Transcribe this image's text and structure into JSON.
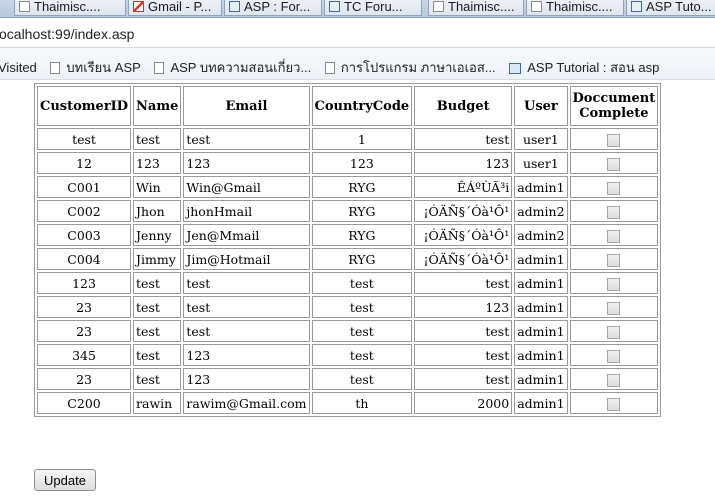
{
  "browser": {
    "tabs": [
      {
        "label": "Thaimisc....",
        "icon": "page-icon"
      },
      {
        "label": "Gmail - P...",
        "icon": "gmail-icon"
      },
      {
        "label": "ASP : For...",
        "icon": "asp-icon"
      },
      {
        "label": "TC Foru...",
        "icon": "asp-icon"
      },
      {
        "label": "Thaimisc....",
        "icon": "page-icon"
      },
      {
        "label": "Thaimisc....",
        "icon": "page-icon"
      },
      {
        "label": "ASP Tuto...",
        "icon": "asp-icon"
      }
    ],
    "address": "ocalhost:99/index.asp",
    "bookmarks": [
      {
        "label": "Visited",
        "icon": ""
      },
      {
        "label": "บทเรียน ASP",
        "icon": "page-icon"
      },
      {
        "label": "ASP บทความสอนเกี่ยว...",
        "icon": "page-icon"
      },
      {
        "label": "การโปรแกรม ภาษาเอเอส...",
        "icon": "page-icon"
      },
      {
        "label": "ASP Tutorial : สอน asp",
        "icon": "asp-icon"
      }
    ]
  },
  "table": {
    "headers": [
      "CustomerID",
      "Name",
      "Email",
      "CountryCode",
      "Budget",
      "User",
      "Doccument Complete"
    ],
    "header_doc_line1": "Doccument",
    "header_doc_line2": "Complete",
    "rows": [
      {
        "id": "test",
        "name": "test",
        "email": "test",
        "country": "1",
        "budget": "test",
        "user": "user1",
        "complete": false
      },
      {
        "id": "12",
        "name": "123",
        "email": "123",
        "country": "123",
        "budget": "123",
        "user": "user1",
        "complete": false
      },
      {
        "id": "C001",
        "name": "Win",
        "email": "Win@Gmail",
        "country": "RYG",
        "budget": "ÊÁºÙÃ³i",
        "user": "admin1",
        "complete": false
      },
      {
        "id": "C002",
        "name": "Jhon",
        "email": "jhonHmail",
        "country": "RYG",
        "budget": "¡ÓÄÑ§´Óà¹Ô¹",
        "user": "admin2",
        "complete": false
      },
      {
        "id": "C003",
        "name": "Jenny",
        "email": "Jen@Mmail",
        "country": "RYG",
        "budget": "¡ÓÄÑ§´Óà¹Ô¹",
        "user": "admin2",
        "complete": false
      },
      {
        "id": "C004",
        "name": "Jimmy",
        "email": "Jim@Hotmail",
        "country": "RYG",
        "budget": "¡ÓÄÑ§´Óà¹Ô¹",
        "user": "admin1",
        "complete": false
      },
      {
        "id": "123",
        "name": "test",
        "email": "test",
        "country": "test",
        "budget": "test",
        "user": "admin1",
        "complete": false
      },
      {
        "id": "23",
        "name": "test",
        "email": "test",
        "country": "test",
        "budget": "123",
        "user": "admin1",
        "complete": false
      },
      {
        "id": "23",
        "name": "test",
        "email": "test",
        "country": "test",
        "budget": "test",
        "user": "admin1",
        "complete": false
      },
      {
        "id": "345",
        "name": "test",
        "email": "123",
        "country": "test",
        "budget": "test",
        "user": "admin1",
        "complete": false
      },
      {
        "id": "23",
        "name": "test",
        "email": "123",
        "country": "test",
        "budget": "test",
        "user": "admin1",
        "complete": false
      },
      {
        "id": "C200",
        "name": "rawin",
        "email": "rawim@Gmail.com",
        "country": "th",
        "budget": "2000",
        "user": "admin1",
        "complete": false
      }
    ]
  },
  "update_label": "Update"
}
